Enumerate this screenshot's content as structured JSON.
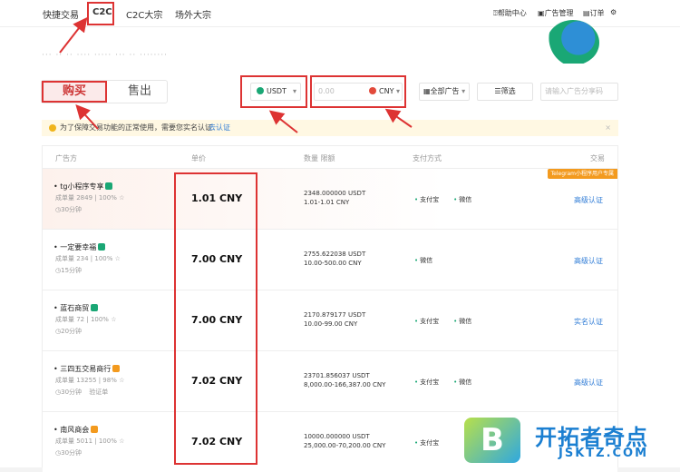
{
  "nav": {
    "tabs": [
      "快捷交易",
      "C2C",
      "C2C大宗",
      "场外大宗"
    ],
    "help": "帮助中心",
    "ad_manage": "广告管理",
    "orders": "订单"
  },
  "hero": {
    "faint_text": "··· ·· ·· ···· ····· ··· ·· ········"
  },
  "trade": {
    "buy": "购买",
    "sell": "售出",
    "coin": "USDT",
    "amount_placeholder": "0.00",
    "fiat": "CNY",
    "ad_filter": "全部广告",
    "filter": "筛选",
    "search_placeholder": "请输入广告分享码"
  },
  "notice": {
    "text": "为了保障交易功能的正常使用，需要您实名认证",
    "link": "去认证"
  },
  "table": {
    "headers": [
      "广告方",
      "单价",
      "数量  限额",
      "支付方式",
      "交易"
    ],
    "badge": "Telegram小程序用户专属",
    "rows": [
      {
        "name": "tg小程序专享",
        "stats": "成单量 2849 | 100%",
        "time": "30分钟",
        "price": "1.01 CNY",
        "qty": "2348.000000 USDT",
        "limit": "1.01-1.01 CNY",
        "pay": [
          "支付宝",
          "微信"
        ],
        "action": "高级认证"
      },
      {
        "name": "一定要幸福",
        "stats": "成单量 234 | 100%",
        "time": "15分钟",
        "price": "7.00 CNY",
        "qty": "2755.622038 USDT",
        "limit": "10.00-500.00 CNY",
        "pay": [
          "微信"
        ],
        "action": "高级认证"
      },
      {
        "name": "蓝石商贸",
        "stats": "成单量 72 | 100%",
        "time": "20分钟",
        "price": "7.00 CNY",
        "qty": "2170.879177 USDT",
        "limit": "10.00-99.00 CNY",
        "pay": [
          "支付宝",
          "微信"
        ],
        "action": "实名认证"
      },
      {
        "name": "三四五交易商行",
        "stats": "成单量 13255 | 98%",
        "time": "30分钟",
        "time2": "验证单",
        "price": "7.02 CNY",
        "qty": "23701.856037 USDT",
        "limit": "8,000.00-166,387.00 CNY",
        "pay": [
          "支付宝",
          "微信"
        ],
        "action": "高级认证"
      },
      {
        "name": "南风商会",
        "stats": "成单量 5011 | 100%",
        "time": "30分钟",
        "price": "7.02 CNY",
        "qty": "10000.000000 USDT",
        "limit": "25,000.00-70,200.00 CNY",
        "pay": [
          "支付宝"
        ],
        "action": ""
      }
    ]
  },
  "watermark": {
    "logo": "B",
    "title": "开拓者奇点",
    "sub": "JSKTZ.COM"
  },
  "colors": {
    "accent_red": "#d33333",
    "green": "#1aa775",
    "link_blue": "#2e7bd6"
  }
}
